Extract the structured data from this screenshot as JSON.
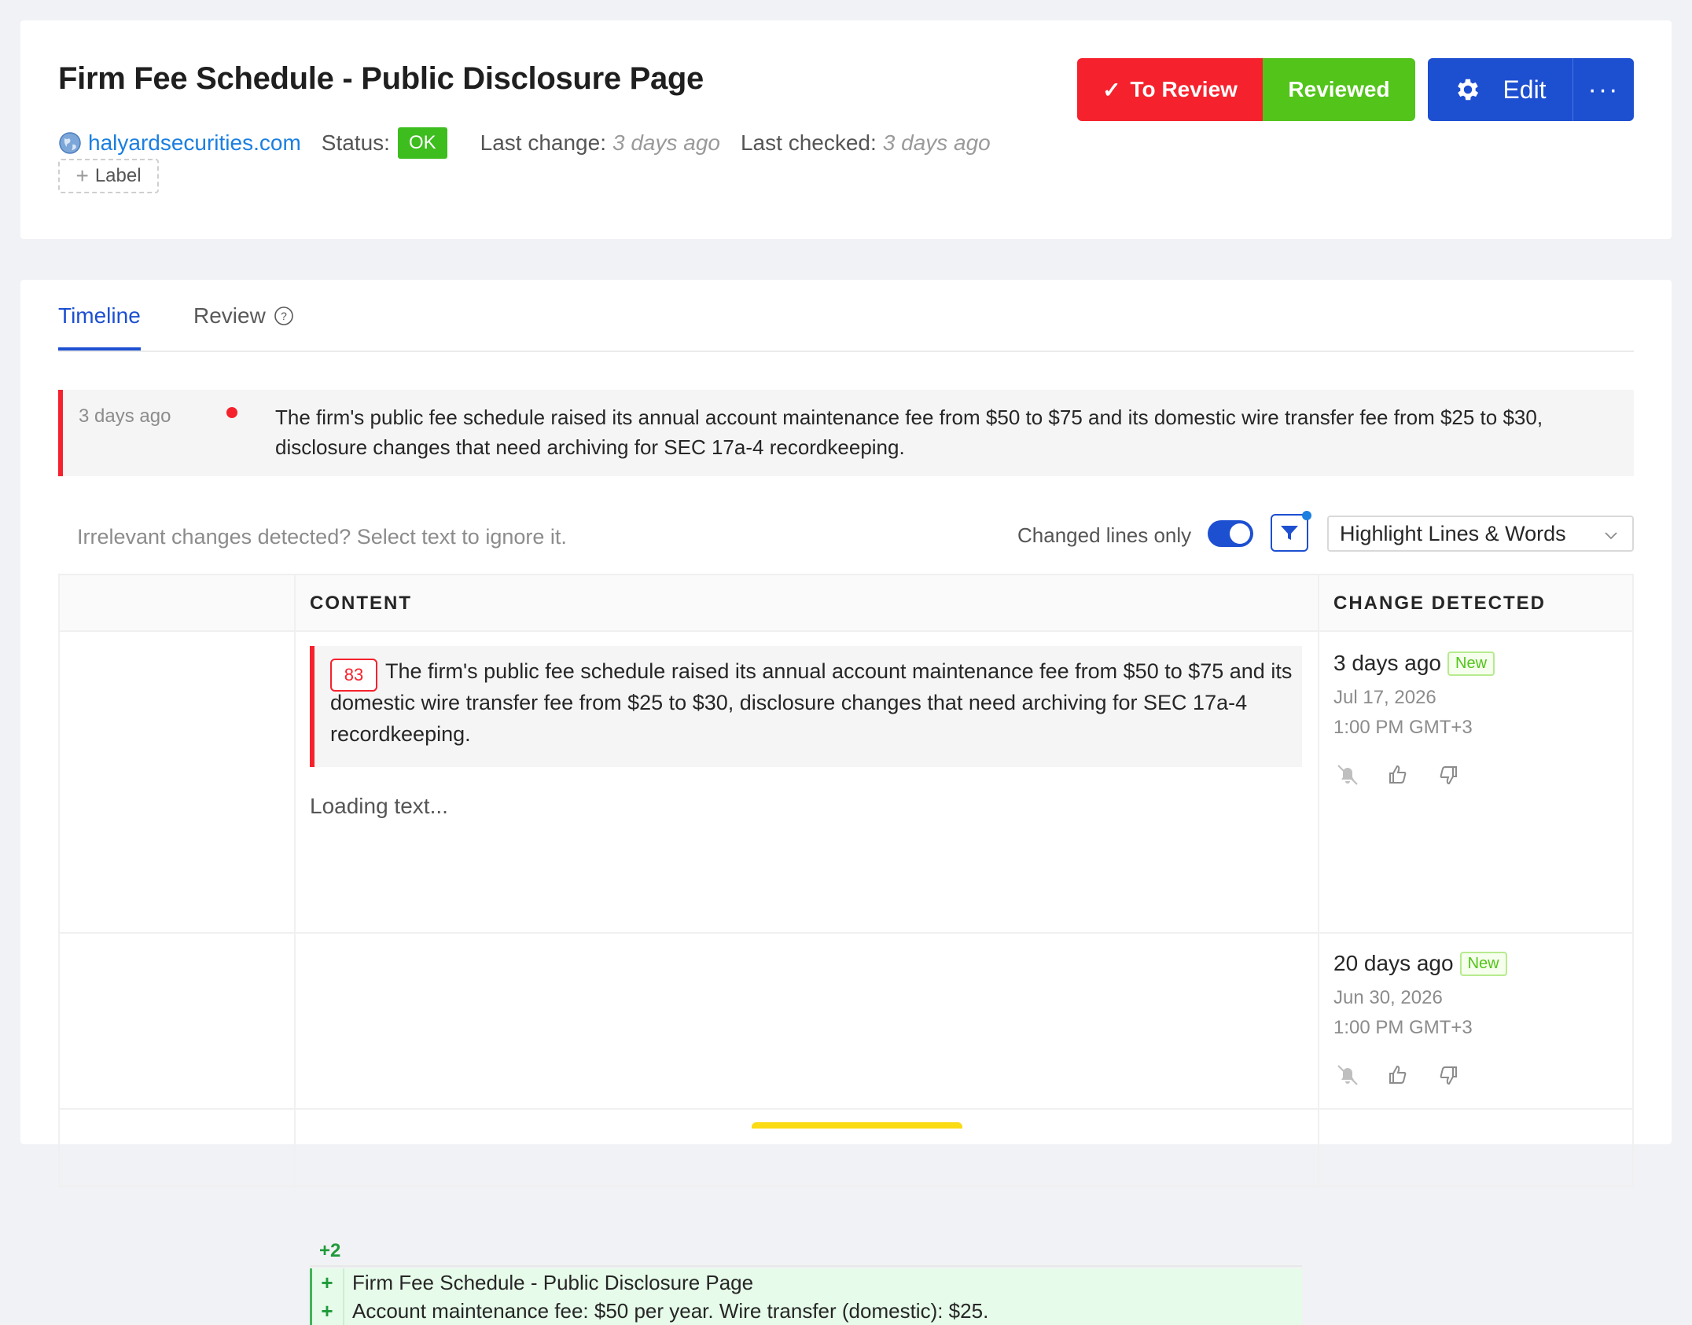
{
  "header": {
    "title": "Firm Fee Schedule - Public Disclosure Page",
    "site": "halyardsecurities.com",
    "status_label": "Status:",
    "status_value": "OK",
    "last_change_label": "Last change:",
    "last_change_value": "3 days ago",
    "last_checked_label": "Last checked:",
    "last_checked_value": "3 days ago",
    "label_button": "Label",
    "to_review_label": "To Review",
    "reviewed_label": "Reviewed",
    "edit_label": "Edit",
    "more_label": "···"
  },
  "tabs": [
    {
      "label": "Timeline",
      "active": true
    },
    {
      "label": "Review",
      "active": false
    }
  ],
  "summary": {
    "time": "3 days ago",
    "text": "The firm's public fee schedule raised its annual account maintenance fee from $50 to $75 and its domestic wire transfer fee from $25 to $30, disclosure changes that need archiving for SEC 17a-4 recordkeeping."
  },
  "controls": {
    "hint": "Irrelevant changes detected? Select text to ignore it.",
    "changed_lines_only": "Changed lines only",
    "changed_lines_only_on": true,
    "highlight_mode": "Highlight Lines & Words"
  },
  "table": {
    "headers": {
      "content": "CONTENT",
      "change_detected": "CHANGE DETECTED"
    },
    "rows": [
      {
        "line_number": "83",
        "change_text": "The firm's public fee schedule raised its annual account maintenance fee from $50 to $75 and its domestic wire transfer fee from $25 to $30, disclosure changes that need archiving for SEC 17a-4 recordkeeping.",
        "loading": "Loading text...",
        "ago": "3 days ago",
        "badge": "New",
        "date": "Jul 17, 2026",
        "time": "1:00 PM GMT+3"
      },
      {
        "diff_count": "+2",
        "diff_lines": [
          {
            "sign": "+",
            "text": "Firm Fee Schedule - Public Disclosure Page"
          },
          {
            "sign": "+",
            "text": "Account maintenance fee: $50 per year. Wire transfer (domestic): $25."
          }
        ],
        "ago": "20 days ago",
        "badge": "New",
        "date": "Jun 30, 2026",
        "time": "1:00 PM GMT+3"
      }
    ]
  },
  "colors": {
    "accent": "#1d4fd1",
    "danger": "#f5222d",
    "success": "#52c41a",
    "link": "#1a7fe0"
  }
}
